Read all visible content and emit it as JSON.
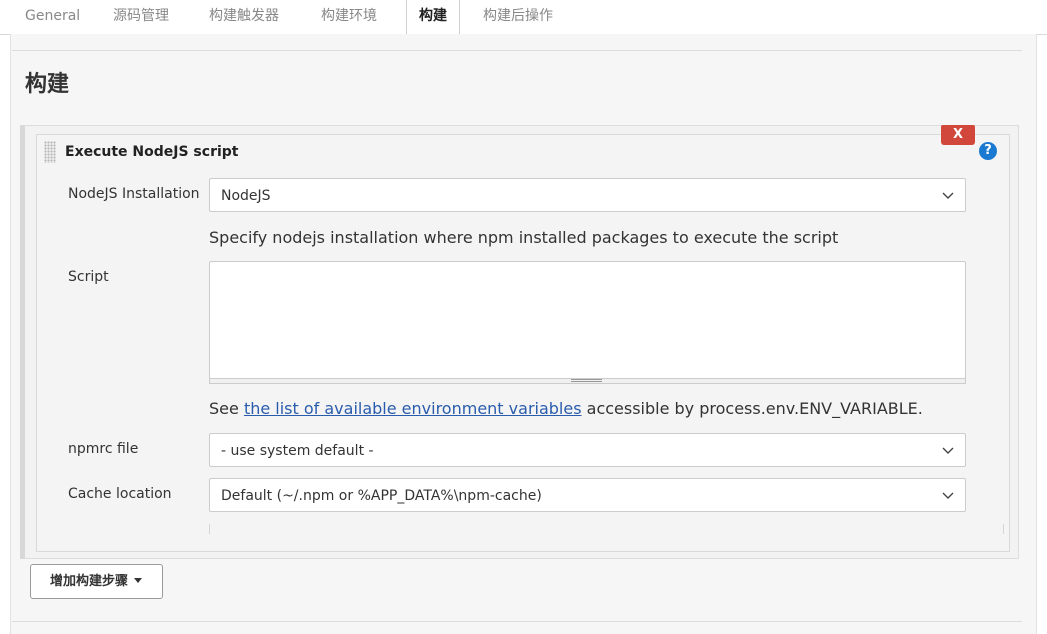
{
  "tabs": [
    {
      "label": "General",
      "active": false
    },
    {
      "label": "源码管理",
      "active": false
    },
    {
      "label": "构建触发器",
      "active": false
    },
    {
      "label": "构建环境",
      "active": false
    },
    {
      "label": "构建",
      "active": true
    },
    {
      "label": "构建后操作",
      "active": false
    }
  ],
  "section": {
    "title": "构建"
  },
  "step": {
    "title": "Execute NodeJS script",
    "delete_label": "X",
    "help_label": "?",
    "nodejs_installation": {
      "label": "NodeJS Installation",
      "value": "NodeJS",
      "description": "Specify nodejs installation where npm installed packages to execute the script"
    },
    "script": {
      "label": "Script",
      "value": "",
      "description_prefix": "See ",
      "description_link": "the list of available environment variables",
      "description_suffix": " accessible by process.env.ENV_VARIABLE."
    },
    "npmrc": {
      "label": "npmrc file",
      "value": "- use system default -"
    },
    "cache": {
      "label": "Cache location",
      "value": "Default (~/.npm or %APP_DATA%\\npm-cache)"
    }
  },
  "add_step_button": {
    "label": "增加构建步骤"
  },
  "colors": {
    "delete": "#d2473b",
    "help": "#1a7ad1",
    "link": "#2a5cad"
  },
  "icons": {
    "chevron": "chevron-down-icon",
    "grip": "drag-handle-icon",
    "help": "help-icon",
    "delete": "close-icon"
  }
}
